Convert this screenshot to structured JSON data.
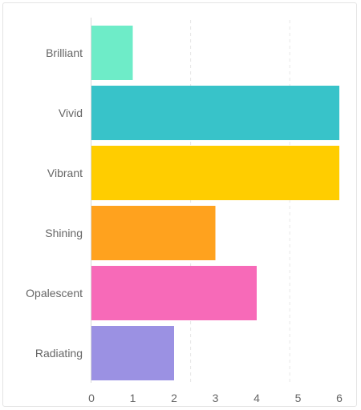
{
  "chart_data": {
    "type": "bar",
    "orientation": "horizontal",
    "categories": [
      "Brilliant",
      "Vivid",
      "Vibrant",
      "Shining",
      "Opalescent",
      "Radiating"
    ],
    "values": [
      1,
      6,
      6,
      3,
      4,
      2
    ],
    "colors": [
      "#6eecc8",
      "#38c3c9",
      "#ffcd00",
      "#ffa21e",
      "#f76ab8",
      "#9b91e3"
    ],
    "xlim": [
      0,
      6
    ],
    "xticks": [
      0,
      1,
      2,
      3,
      4,
      5,
      6
    ],
    "grid": "dashed vertical lines at 2.4 and 4.8",
    "legend": "none",
    "title": "",
    "xlabel": "",
    "ylabel": ""
  }
}
